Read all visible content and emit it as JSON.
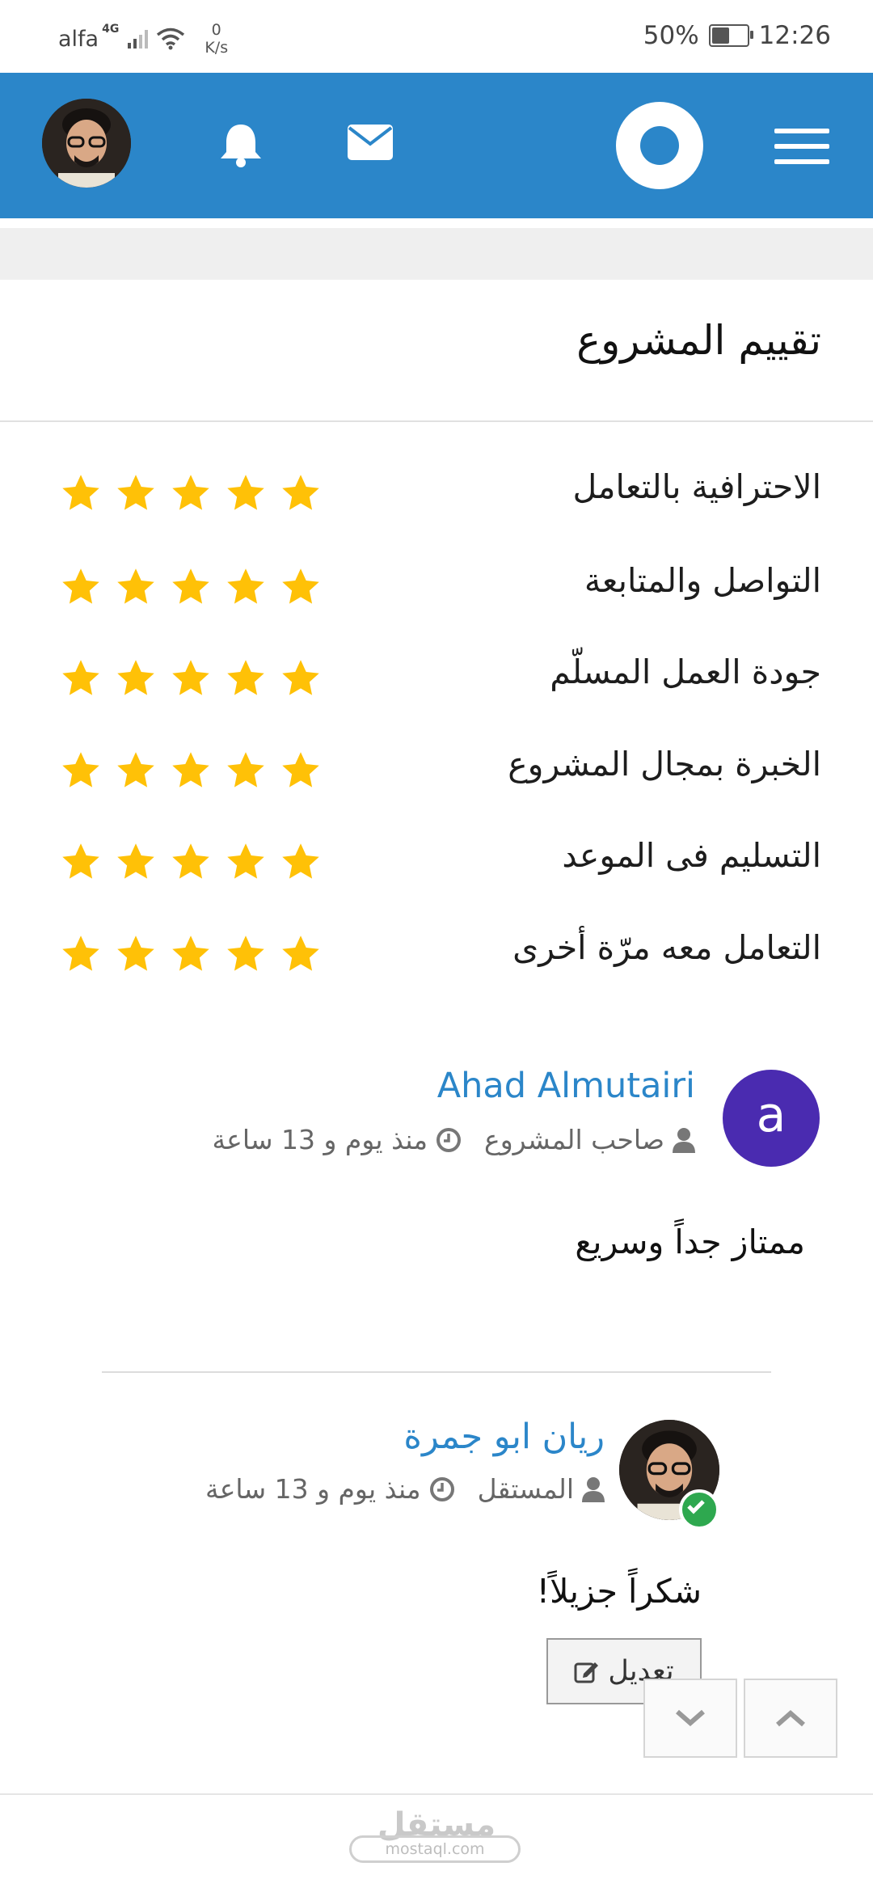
{
  "status_bar": {
    "carrier": "alfa",
    "network": "4G",
    "speed_value": "0",
    "speed_unit": "K/s",
    "battery": "50%",
    "battery_level": 0.5,
    "time": "12:26"
  },
  "header": {
    "menu_icon": "hamburger-menu-icon",
    "logo_icon": "mostaql-logo-icon",
    "mail_icon": "envelope-icon",
    "notifications_icon": "bell-icon",
    "accent_color": "#2b86c9"
  },
  "rating_section": {
    "title": "تقييم المشروع",
    "star_color": "#ffc107",
    "items": [
      {
        "label": "الاحترافية بالتعامل",
        "rating": 5
      },
      {
        "label": "التواصل والمتابعة",
        "rating": 5
      },
      {
        "label": "جودة العمل المسلّم",
        "rating": 5
      },
      {
        "label": "الخبرة بمجال المشروع",
        "rating": 5
      },
      {
        "label": "التسليم فى الموعد",
        "rating": 5
      },
      {
        "label": "التعامل معه مرّة أخرى",
        "rating": 5
      }
    ]
  },
  "comments": [
    {
      "avatar_letter": "a",
      "name": "Ahad Almutairi",
      "role": "صاحب المشروع",
      "time": "منذ يوم و 13 ساعة",
      "body": "ممتاز جداً وسريع"
    },
    {
      "name": "ريان ابو جمرة",
      "role": "المستقل",
      "time": "منذ يوم و 13 ساعة",
      "body": "شكراً جزيلاً!",
      "edit_label": "تعديل"
    }
  ],
  "footer": {
    "logo_text": "مستقل",
    "logo_domain": "mostaql.com"
  }
}
